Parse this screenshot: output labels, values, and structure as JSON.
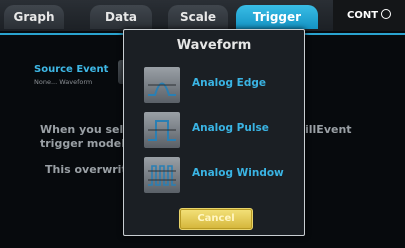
{
  "tabs": [
    {
      "label": "Graph"
    },
    {
      "label": "Data"
    },
    {
      "label": "Scale"
    },
    {
      "label": "Trigger"
    }
  ],
  "cont_label": "CONT",
  "background": {
    "source_event_label": "Source Event",
    "source_event_value": "None... Waveform",
    "line1": "When you sel",
    "line1_right": "illEvent",
    "line2": "trigger model",
    "line3": "This overwrit"
  },
  "dialog": {
    "title": "Waveform",
    "options": [
      {
        "label": "Analog Edge",
        "icon": "analog-edge-icon"
      },
      {
        "label": "Analog Pulse",
        "icon": "analog-pulse-icon"
      },
      {
        "label": "Analog Window",
        "icon": "analog-window-icon"
      }
    ],
    "cancel_label": "Cancel"
  },
  "colors": {
    "active_tab": "#1b9fd0",
    "accent_text": "#3ab4e4",
    "cancel_button": "#e6cc55"
  }
}
